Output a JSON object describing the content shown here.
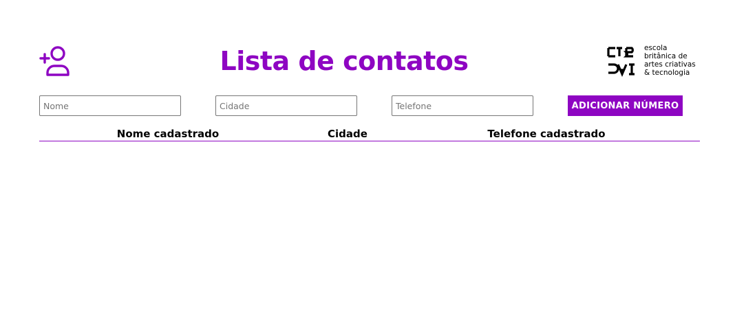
{
  "header": {
    "title": "Lista de contatos",
    "icon": "add-user-icon",
    "accent_color": "#8e05c2"
  },
  "logo": {
    "lines": [
      "escola",
      "britânica de",
      "artes criativas",
      "& tecnologia"
    ]
  },
  "form": {
    "name_placeholder": "Nome",
    "city_placeholder": "Cidade",
    "phone_placeholder": "Telefone",
    "name_value": "",
    "city_value": "",
    "phone_value": "",
    "submit_label": "ADICIONAR NÚMERO"
  },
  "table": {
    "columns": [
      "Nome cadastrado",
      "Cidade",
      "Telefone cadastrado"
    ],
    "rows": []
  }
}
